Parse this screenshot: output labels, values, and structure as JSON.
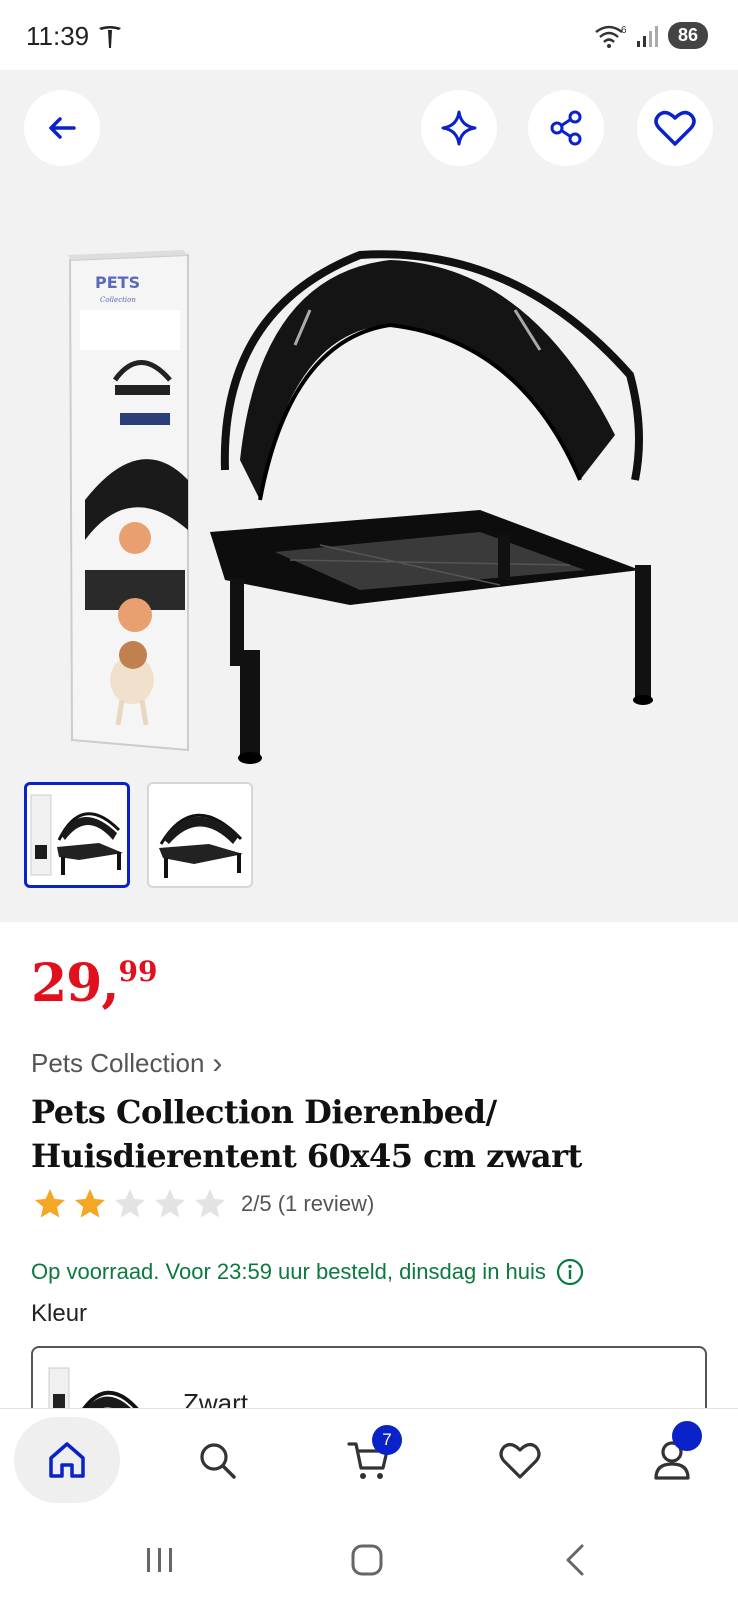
{
  "status_bar": {
    "time": "11:39",
    "battery": "86"
  },
  "gallery": {
    "selected_thumb": 1
  },
  "price": {
    "main": "29,",
    "cents": "99"
  },
  "brand": {
    "label": "Pets Collection",
    "chevron": "›"
  },
  "product": {
    "title": "Pets Collection Dierenbed/ Huisdierentent 60x45 cm zwart",
    "rating_value": 2,
    "rating_max": 5,
    "rating_text": "2/5 (1 review)",
    "stock_text": "Op voorraad. Voor 23:59 uur besteld, dinsdag in huis"
  },
  "variant": {
    "label": "Kleur",
    "selected": "Zwart"
  },
  "bottom_nav": {
    "cart_count": "7"
  },
  "colors": {
    "accent": "#0a22c9",
    "price": "#e0101c",
    "stock": "#0c7a3f",
    "star": "#f5a623"
  },
  "icons": [
    "tesla-icon",
    "wifi-icon",
    "signal-icon",
    "back-arrow-icon",
    "sparkle-icon",
    "share-icon",
    "heart-icon",
    "chevron-right-icon",
    "star-icon",
    "info-icon",
    "home-icon",
    "search-icon",
    "cart-icon",
    "account-icon"
  ]
}
